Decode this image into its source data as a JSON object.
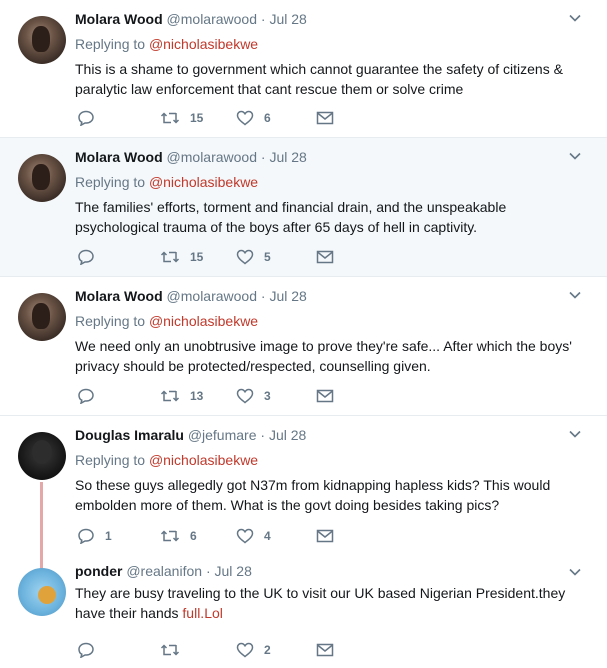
{
  "tweets": [
    {
      "name": "Molara Wood",
      "handle": "@molarawood",
      "sep": "·",
      "time": "Jul 28",
      "replying_prefix": "Replying to ",
      "replying_to": "@nicholasibekwe",
      "text_lines": [
        "This is a shame to government which cannot guarantee the safety of citizens &",
        "paralytic law enforcement that cant rescue them or solve crime"
      ],
      "reply_count": "",
      "retweet_count": "15",
      "like_count": "6"
    },
    {
      "name": "Molara Wood",
      "handle": "@molarawood",
      "sep": "·",
      "time": "Jul 28",
      "replying_prefix": "Replying to ",
      "replying_to": "@nicholasibekwe",
      "text_lines": [
        "The families' efforts, torment and financial drain, and the unspeakable",
        "psychological trauma of the boys after 65 days of hell in captivity."
      ],
      "reply_count": "",
      "retweet_count": "15",
      "like_count": "5"
    },
    {
      "name": "Molara Wood",
      "handle": "@molarawood",
      "sep": "·",
      "time": "Jul 28",
      "replying_prefix": "Replying to ",
      "replying_to": "@nicholasibekwe",
      "text_lines": [
        "We need only an unobtrusive image to prove they're safe... After which the boys'",
        "privacy should be protected/respected, counselling given."
      ],
      "reply_count": "",
      "retweet_count": "13",
      "like_count": "3"
    },
    {
      "name": "Douglas Imaralu",
      "handle": "@jefumare",
      "sep": "·",
      "time": "Jul 28",
      "replying_prefix": "Replying to ",
      "replying_to": "@nicholasibekwe",
      "text_lines": [
        "So these guys allegedly got N37m from kidnapping hapless kids? This would",
        "embolden more of them. What is the govt doing besides taking pics?"
      ],
      "reply_count": "1",
      "retweet_count": "6",
      "like_count": "4"
    },
    {
      "name": "ponder",
      "handle": "@realanifon",
      "sep": "·",
      "time": "Jul 28",
      "text_line1": "They are busy traveling to the UK to visit our UK based Nigerian President.they",
      "text_line2_plain": "have their hands ",
      "text_line2_link": "full.Lol",
      "reply_count": "",
      "retweet_count": "",
      "like_count": "2"
    }
  ],
  "colors": {
    "link": "#c0392b",
    "muted": "#657786",
    "highlight_bg": "#f5f8fa",
    "thread_line": "#e5a8a8"
  }
}
